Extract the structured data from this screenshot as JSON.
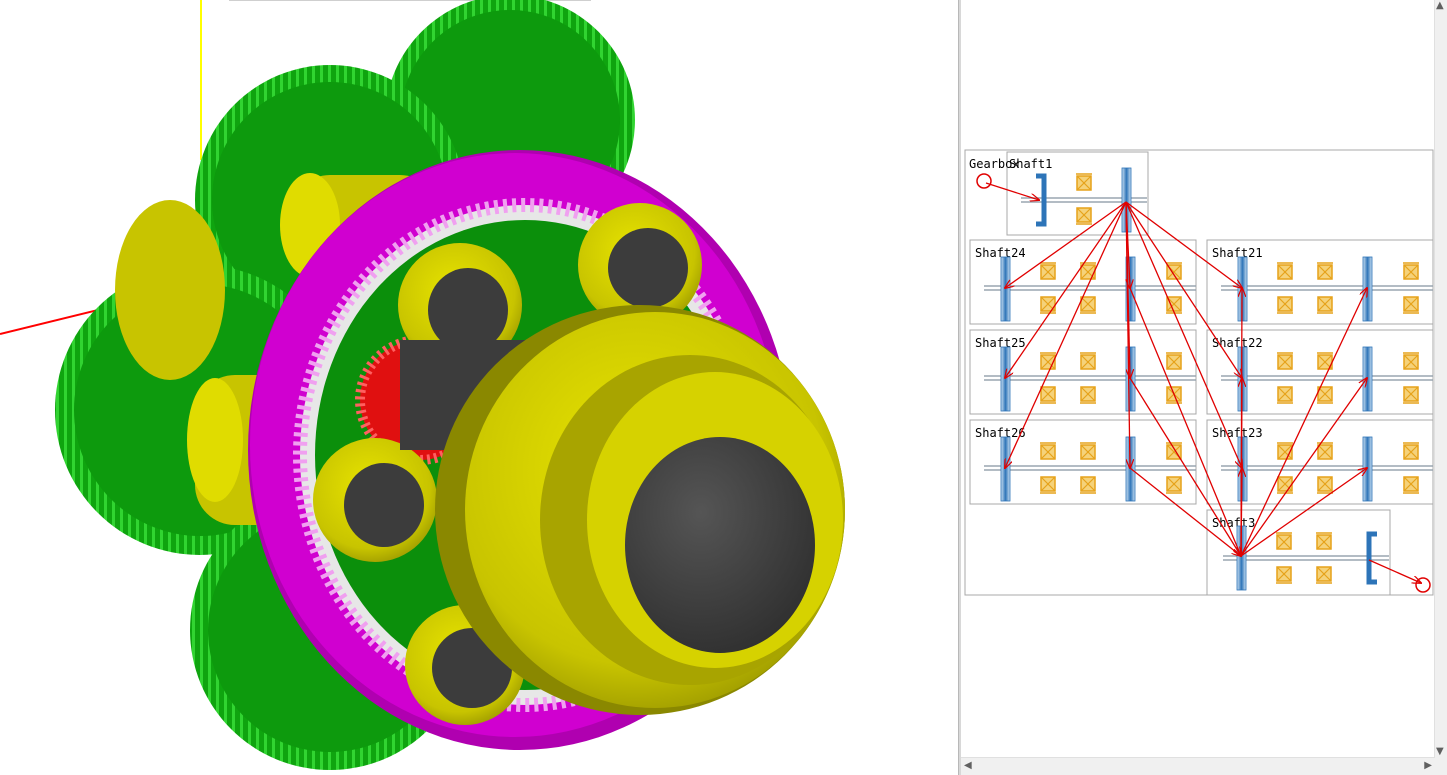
{
  "viewport3d": {
    "colors": {
      "planet_gear": "#0fa40f",
      "planet_gear_teeth": "#22d022",
      "ring_gear": "#c800c8",
      "sun_gear": "#e01010",
      "carrier": "#d6d200",
      "carrier_shade": "#8a8800",
      "hub": "#3c3c3c",
      "axis_y": "#ffff00",
      "axis_x": "#ff0000"
    },
    "hub_symbols": [
      "cw-arrow-icon",
      "ccw-arrow-icon",
      "bearing-icon",
      "bearing-icon"
    ]
  },
  "diagram": {
    "root_label": "Gearbox",
    "shafts": [
      {
        "id": "shaft1",
        "label": "Shaft1"
      },
      {
        "id": "shaft24",
        "label": "Shaft24"
      },
      {
        "id": "shaft21",
        "label": "Shaft21"
      },
      {
        "id": "shaft25",
        "label": "Shaft25"
      },
      {
        "id": "shaft22",
        "label": "Shaft22"
      },
      {
        "id": "shaft26",
        "label": "Shaft26"
      },
      {
        "id": "shaft23",
        "label": "Shaft23"
      },
      {
        "id": "shaft3",
        "label": "Shaft3"
      }
    ],
    "colors": {
      "gear_blue": "#2d74b8",
      "gear_light": "#cfe3f4",
      "bearing_orange": "#e6a21a",
      "bearing_fill": "#f5d27a",
      "link_red": "#e00000",
      "box_border": "#a8a8a8",
      "shaft_gray": "#9aa6b0"
    }
  },
  "scrollbars": {
    "up_arrow": "▲",
    "down_arrow": "▼",
    "left_arrow": "◀",
    "right_arrow": "▶"
  }
}
